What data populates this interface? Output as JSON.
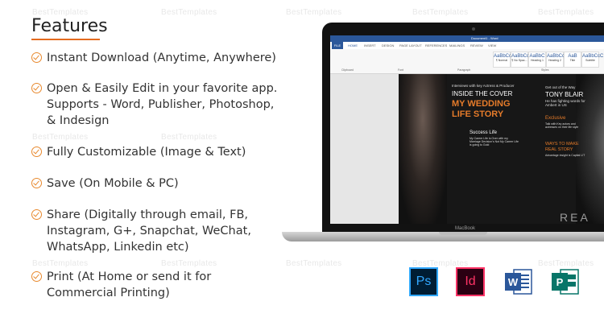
{
  "watermarks": [
    "BestTemplates"
  ],
  "heading": "Features",
  "features": [
    "Instant Download (Anytime, Anywhere)",
    "Open & Easily Edit in your favorite app.\nSupports - Word, Publisher, Photoshop,\n& Indesign",
    "Fully Customizable (Image & Text)",
    "Save (On Mobile & PC)",
    "Share (Digitally through email, FB,\nInstagram, G+, Snapchat, WeChat,\nWhatsApp, Linkedin etc)",
    "Print (At Home or send it for\nCommercial Printing)"
  ],
  "laptop": {
    "brand": "MacBook",
    "word": {
      "doc_title": "Document1 - Word",
      "file_tab": "FILE",
      "tabs": [
        "HOME",
        "INSERT",
        "DESIGN",
        "PAGE LAYOUT",
        "REFERENCES",
        "MAILINGS",
        "REVIEW",
        "VIEW"
      ],
      "groups": [
        "Clipboard",
        "Font",
        "Paragraph",
        "Styles"
      ],
      "styles": [
        {
          "sample": "AaBbCcDc",
          "name": "¶ Normal"
        },
        {
          "sample": "AaBbCcDc",
          "name": "¶ No Spac..."
        },
        {
          "sample": "AaBbC",
          "name": "Heading 1"
        },
        {
          "sample": "AaBbCcC",
          "name": "Heading 2"
        },
        {
          "sample": "AaB",
          "name": "Title"
        },
        {
          "sample": "AaBbCcC",
          "name": "Subtitle"
        }
      ]
    },
    "magazine": {
      "tag": "Interviews with key Actress & Producer",
      "headline1": "INSIDE THE COVER",
      "headline2": "MY WEDDING",
      "headline3": "LIFE STORY",
      "sub1": "Success Life",
      "sub1_text": "My Career Life is Over with my Marriage Decision's Not My Career Life is going to Gold",
      "right_tag": "Get out of the Way",
      "right_name": "TONY BLAIR",
      "right_text": "He has fighting words for Ambert in US",
      "exclusive": "Exclusive",
      "exclusive_text": "Talk with Key actors and actresses on their life style",
      "ways1": "WAYS TO MAKE",
      "ways2": "REAL STORY",
      "ways_text": "Advantage insight is Capital LIT",
      "footer_letters": "REA"
    }
  },
  "apps": [
    {
      "label": "Ps",
      "icon": "photoshop-icon"
    },
    {
      "label": "Id",
      "icon": "indesign-icon"
    },
    {
      "label": "W",
      "icon": "word-icon"
    },
    {
      "label": "P",
      "icon": "publisher-icon"
    }
  ]
}
